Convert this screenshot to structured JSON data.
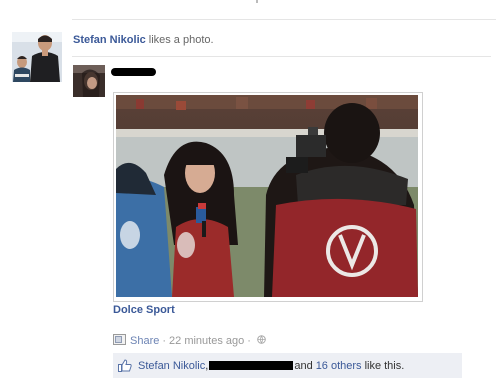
{
  "story": {
    "actor": "Stefan Nikolic",
    "verb": "likes a photo."
  },
  "post": {
    "caption": "Dolce Sport",
    "actions": {
      "share": "Share",
      "separator": "·",
      "timestamp": "22 minutes ago",
      "privacy_icon": "globe-icon"
    }
  },
  "likes": {
    "first": "Stefan Nikolic",
    "comma": ",",
    "conjunction": "and",
    "others": "16 others",
    "suffix": "like this."
  },
  "icons": {
    "share": "share-icon",
    "like": "thumbs-up-icon"
  },
  "colors": {
    "link": "#3b5998",
    "muted": "#999999",
    "likes_bg": "#edeff4"
  }
}
